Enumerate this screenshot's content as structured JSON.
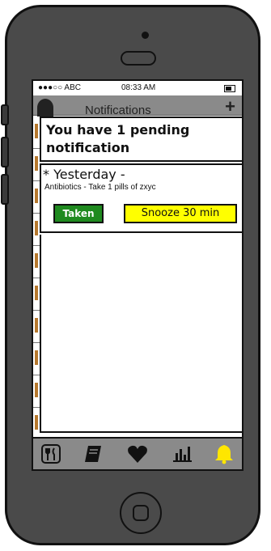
{
  "status_bar": {
    "carrier": "●●●○○ ABC",
    "time": "08:33 AM"
  },
  "nav": {
    "title": "Notifications",
    "add_icon": "plus-icon",
    "back_icon": "user-icon"
  },
  "banner": {
    "text": "You have 1 pending notification"
  },
  "notification": {
    "when": "* Yesterday -",
    "description": "Antibiotics - Take 1 pills of zxyc",
    "taken_label": "Taken",
    "snooze_label": "Snooze 30 min"
  },
  "tabs": [
    {
      "icon": "fork-knife-icon",
      "active": false
    },
    {
      "icon": "book-icon",
      "active": false
    },
    {
      "icon": "heart-icon",
      "active": false
    },
    {
      "icon": "chart-icon",
      "active": false
    },
    {
      "icon": "bell-icon",
      "active": true
    }
  ],
  "colors": {
    "taken": "#1f8a1f",
    "snooze": "#ffff00",
    "active_tab": "#ffe600",
    "phone": "#4a4a4a",
    "bar": "#8a8a8a"
  }
}
